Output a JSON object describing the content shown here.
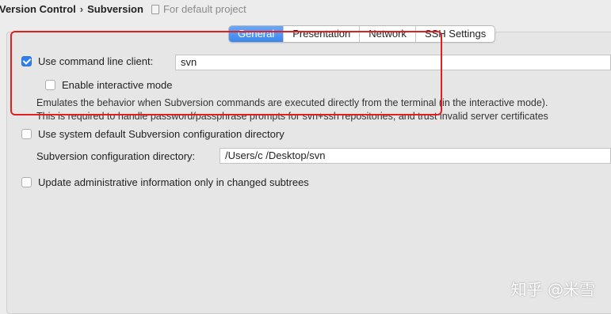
{
  "breadcrumb": {
    "items": [
      "Version Control",
      "Subversion"
    ],
    "hint": "For default project"
  },
  "tabs": [
    {
      "label": "General",
      "active": true
    },
    {
      "label": "Presentation",
      "active": false
    },
    {
      "label": "Network",
      "active": false
    },
    {
      "label": "SSH Settings",
      "active": false
    }
  ],
  "general": {
    "use_command_line_client": {
      "label": "Use command line client:",
      "checked": true,
      "value": "svn"
    },
    "interactive_mode": {
      "label": "Enable interactive mode",
      "checked": false
    },
    "description_line1": "Emulates the behavior when Subversion commands are executed directly from the terminal (in the interactive mode).",
    "description_line2": "This is required to handle password/passphrase prompts for svn+ssh repositories, and trust invalid server certificates",
    "system_default_config": {
      "label": "Use system default Subversion configuration directory",
      "checked": false
    },
    "config_directory": {
      "label": "Subversion configuration directory:",
      "value": "/Users/c        /Desktop/svn"
    },
    "update_changed_subtrees": {
      "label": "Update administrative information only in changed subtrees",
      "checked": false
    }
  },
  "annotation": {
    "color": "#e0201e"
  },
  "watermark": "知乎 @米雪",
  "colors": {
    "accent": "#2f7ff0",
    "tab_active": "#3b86ee"
  }
}
